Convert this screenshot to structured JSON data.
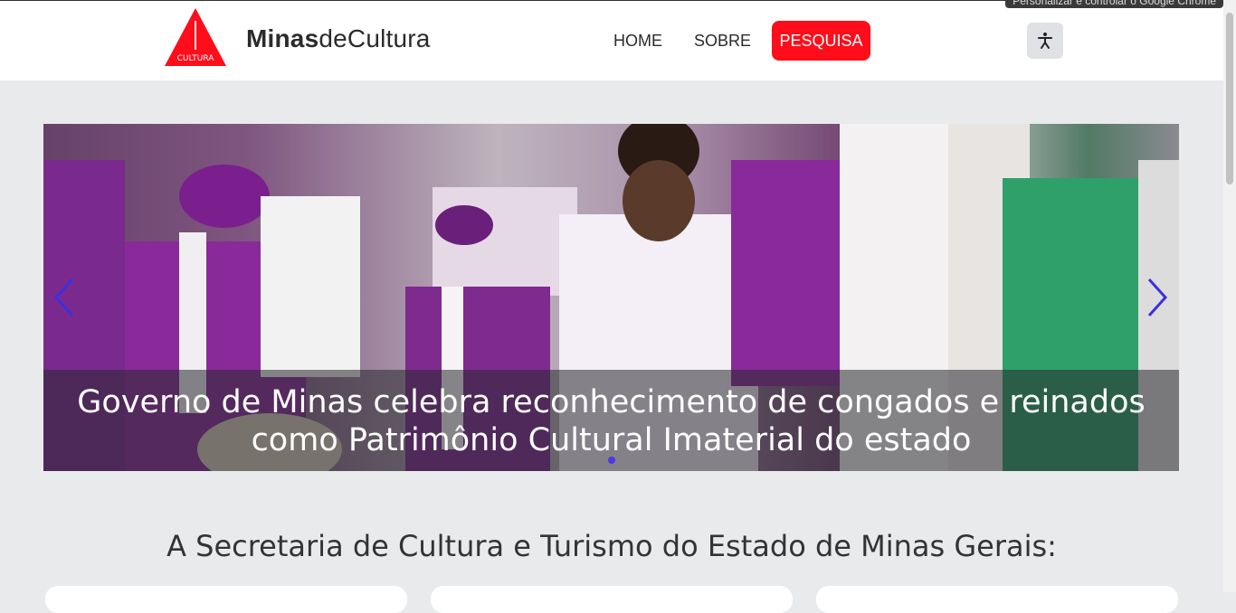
{
  "browser": {
    "tooltip": "Personalizar e controlar o Google Chrome"
  },
  "header": {
    "logo_text": "CULTURA",
    "brand_bold": "Minas",
    "brand_light": "deCultura",
    "nav": {
      "home": "HOME",
      "sobre": "SOBRE",
      "pesquisa": "PESQUISA"
    },
    "accessibility_icon": "accessibility-icon",
    "accent": "#ff0d1a"
  },
  "carousel": {
    "caption": "Governo de Minas celebra reconhecimento de congados e reinados como Patrimônio Cultural Imaterial do estado",
    "prev_icon": "chevron-left-icon",
    "next_icon": "chevron-right-icon",
    "active_slide": 1,
    "slide_count": 1,
    "arrow_color": "#3b2fe0"
  },
  "section": {
    "title": "A Secretaria de Cultura e Turismo do Estado de Minas Gerais:"
  }
}
